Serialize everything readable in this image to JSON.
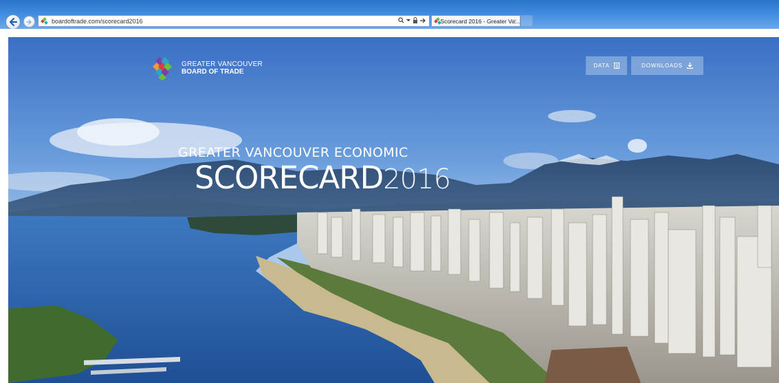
{
  "browser": {
    "url": "boardoftrade.com/scorecard2016",
    "tab_title": "Scorecard 2016 - Greater Va...",
    "tab_close": "×",
    "address_icons": "⌕ ▾ 🔒 →"
  },
  "site": {
    "logo": {
      "line1": "GREATER VANCOUVER",
      "line2": "BOARD OF TRADE"
    },
    "nav": {
      "data_label": "DATA",
      "downloads_label": "DOWNLOADS"
    },
    "hero": {
      "eyebrow": "GREATER VANCOUVER ECONOMIC",
      "title_word": "SCORECARD",
      "title_year": "2016"
    }
  },
  "colors": {
    "chrome_blue": "#3f8be0",
    "button_bg": "#bed7f0",
    "logo_red": "#e03b3b",
    "logo_green": "#6cbf3c",
    "logo_purple": "#7d3fa6",
    "logo_teal": "#2aa6c6",
    "logo_orange": "#f29a2e"
  },
  "icons": {
    "back": "arrow-left-icon",
    "forward": "arrow-right-icon",
    "data": "document-icon",
    "downloads": "download-icon"
  }
}
